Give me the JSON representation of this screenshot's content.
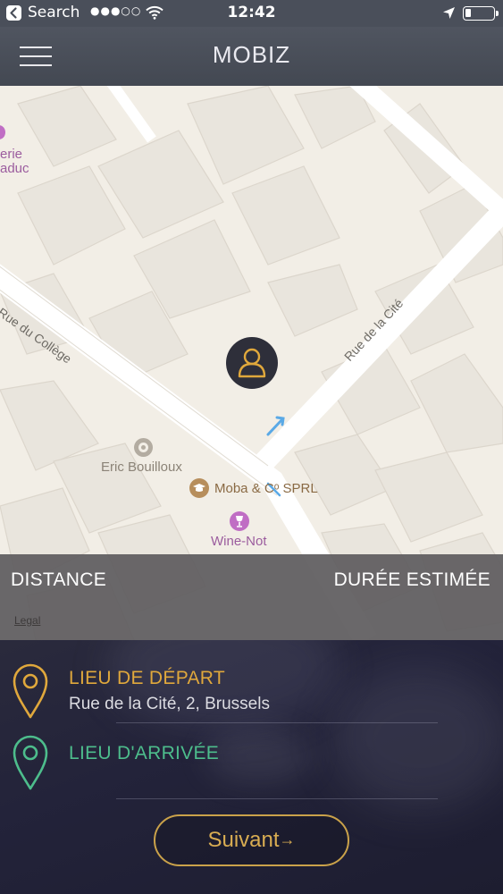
{
  "status_bar": {
    "back_app": "Search",
    "signal": "●●●○○",
    "time": "12:42",
    "battery_level": 0.2
  },
  "header": {
    "title": "MOBIZ",
    "menu_icon": "hamburger-menu-icon"
  },
  "map": {
    "street_labels": [
      "Rue du Collège",
      "Rue de la Cité"
    ],
    "partial_labels": [
      "erie",
      "aduc"
    ],
    "pois": [
      {
        "name": "Eric Bouilloux",
        "icon": "place-pin-icon"
      },
      {
        "name": "Moba & Cᵒ SPRL",
        "icon": "graduation-cap-icon"
      },
      {
        "name": "Wine-Not",
        "icon": "wine-glass-icon"
      }
    ],
    "user_marker_icon": "person-icon"
  },
  "info_bar": {
    "distance_label": "DISTANCE",
    "duration_label": "DURÉE ESTIMÉE",
    "legal_link": "Legal"
  },
  "departure": {
    "title": "LIEU DE DÉPART",
    "address": "Rue de la Cité, 2, Brussels",
    "color": "#e0a83c"
  },
  "arrival": {
    "title": "LIEU D'ARRIVÉE",
    "address": "",
    "color": "#4dbd8c"
  },
  "next_button": {
    "label": "Suivant",
    "color": "#d9ad52"
  }
}
